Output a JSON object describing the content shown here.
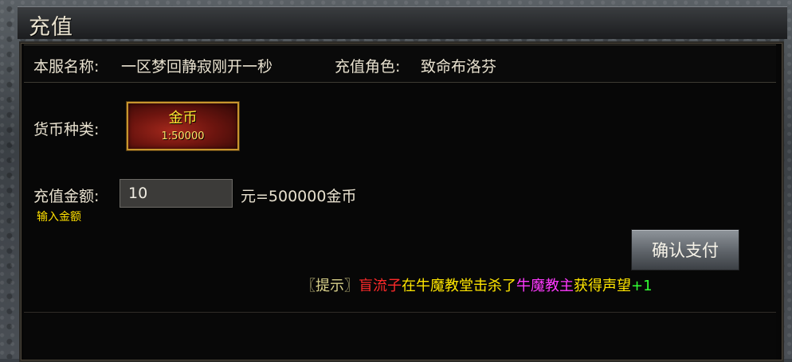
{
  "window": {
    "title": "充值"
  },
  "server": {
    "name_label": "本服名称:",
    "name_value": "一区梦回静寂刚开一秒",
    "role_label": "充值角色:",
    "role_value": "致命布洛芬"
  },
  "currency": {
    "label": "货币种类:",
    "option_name": "金币",
    "option_ratio": "1:50000"
  },
  "amount": {
    "label": "充值金额:",
    "value": "10",
    "hint": "输入金额",
    "result": "元=500000金币"
  },
  "confirm": {
    "label": "确认支付"
  },
  "tip": {
    "prefix": "〖提示〗",
    "player": "盲流子",
    "middle": "在牛魔教堂击杀了",
    "monster": "牛魔教主",
    "reward": "获得声望",
    "amount": "+1"
  },
  "colors": {
    "tip_prefix": "#d8d08a",
    "player": "#ff2a2a",
    "middle": "#ffe600",
    "monster": "#ff39ff",
    "reward": "#ffe600",
    "amount": "#33ff33"
  }
}
